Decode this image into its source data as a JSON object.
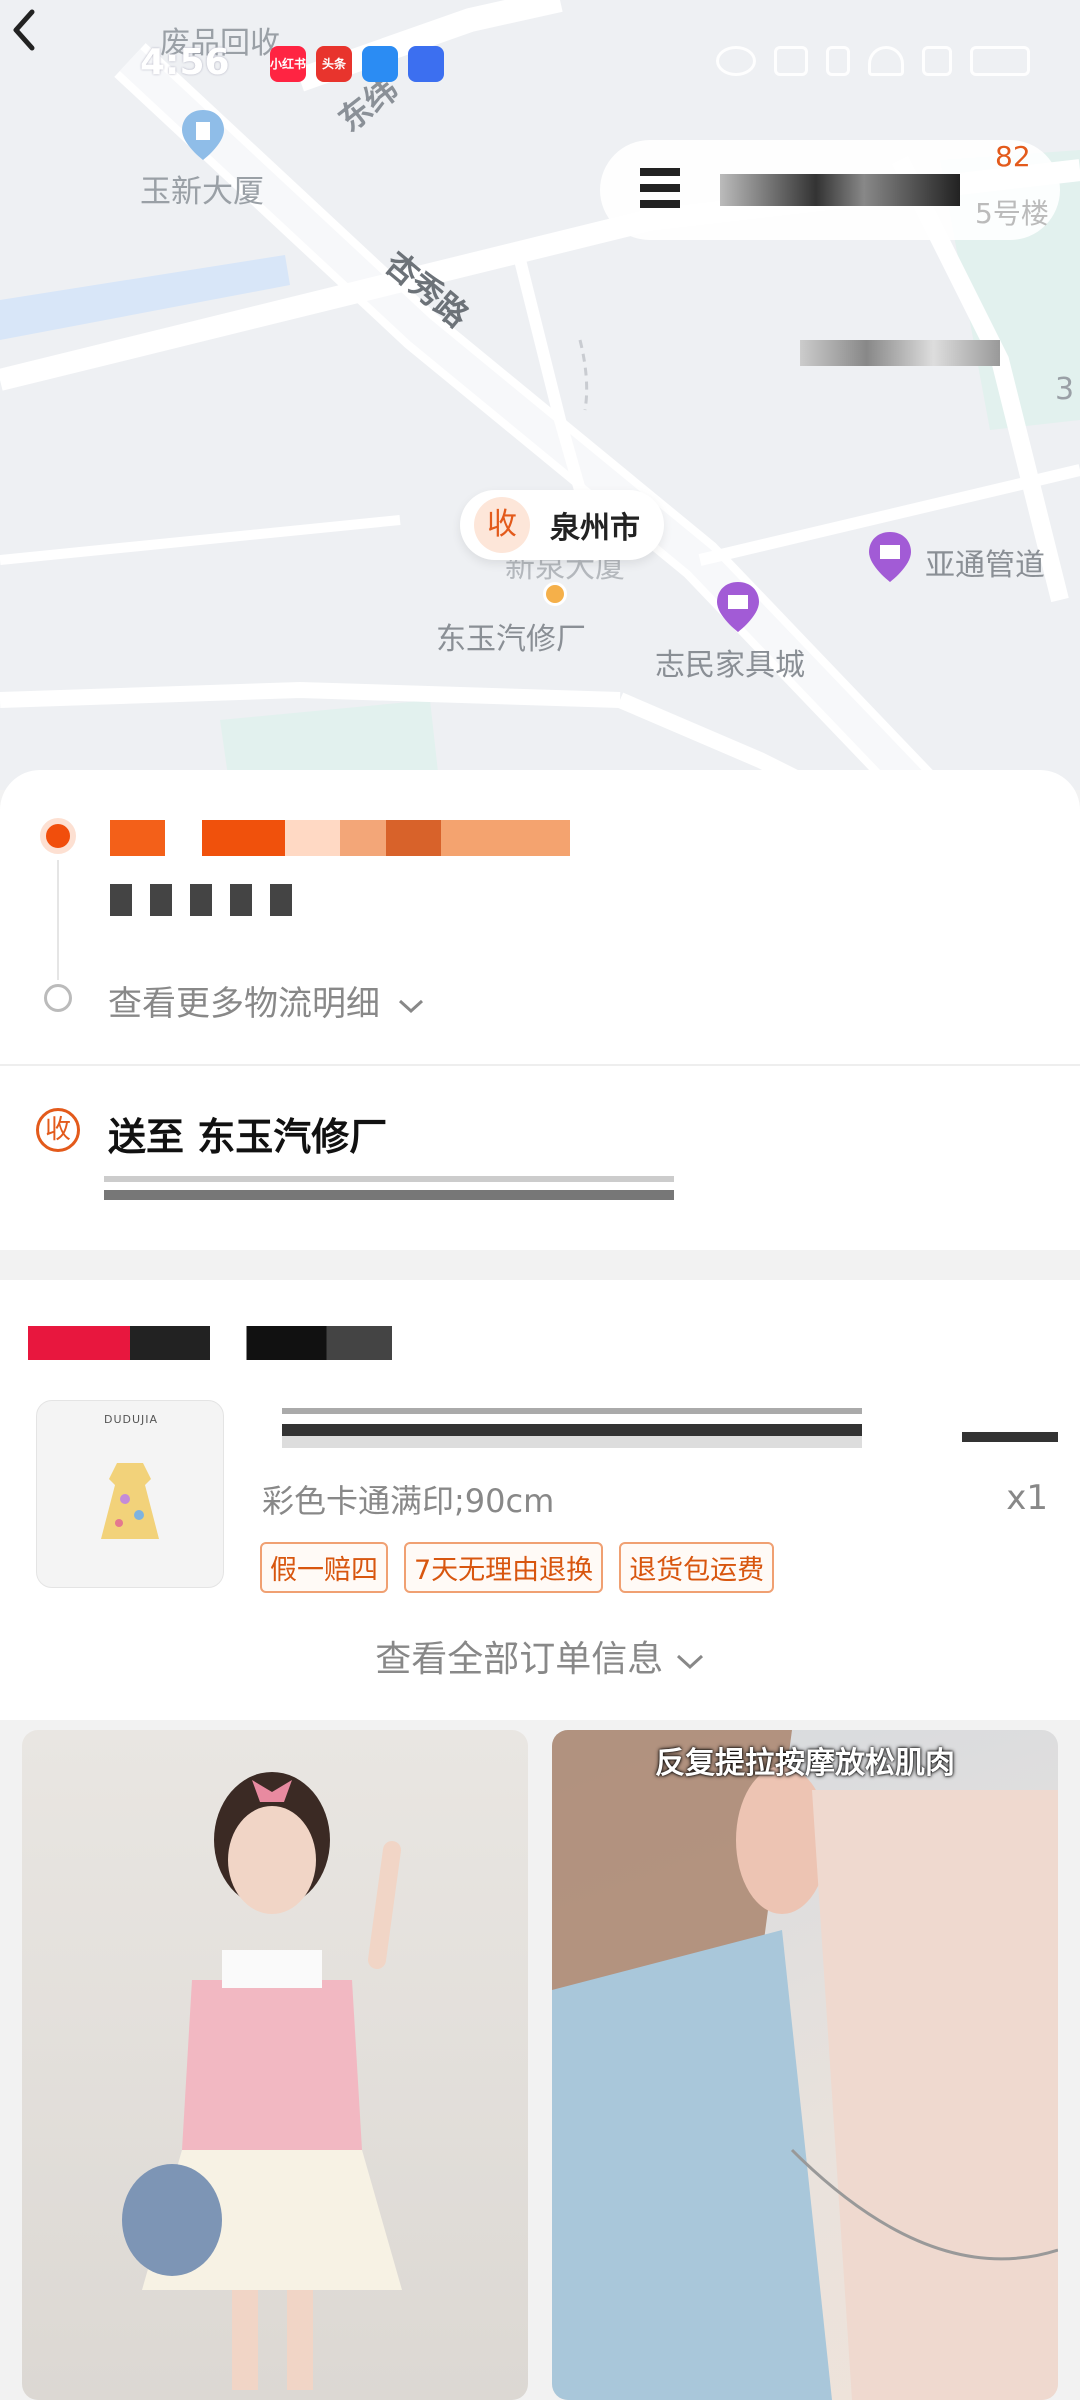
{
  "status_bar": {
    "time": "4:56",
    "apps": [
      {
        "name": "小红书",
        "color": "#ff2442"
      },
      {
        "name": "头条",
        "color": "#e8342d"
      },
      {
        "name": "",
        "color": "#2b8cf3"
      },
      {
        "name": "",
        "color": "#3c6ff0"
      }
    ]
  },
  "map": {
    "labels": {
      "waste": "废品回收",
      "yuxin": "玉新大厦",
      "dongwei": "东纬",
      "xingxiu_road": "杏秀路",
      "building5": "5号楼",
      "num3": "3",
      "yatong": "亚通管道",
      "dongyu_repair": "东玉汽修厂",
      "zhimin": "志民家具城",
      "building_partial": "新泉大厦"
    },
    "top_right_count": "82",
    "pin": {
      "icon": "收",
      "city": "泉州市"
    }
  },
  "logistics": {
    "more_label": "查看更多物流明细",
    "receiver_icon": "收",
    "deliver_to": "送至 东玉汽修厂"
  },
  "order": {
    "thumb_brand": "DUDUJIA",
    "spec": "彩色卡通满印;90cm",
    "quantity": "x1",
    "tags": [
      "假一赔四",
      "7天无理由退换",
      "退货包运费"
    ],
    "view_all": "查看全部订单信息"
  },
  "feed": {
    "right_caption": "反复提拉按摩放松肌肉"
  },
  "colors": {
    "accent": "#e35a1b",
    "active_dot": "#f14e0c"
  }
}
